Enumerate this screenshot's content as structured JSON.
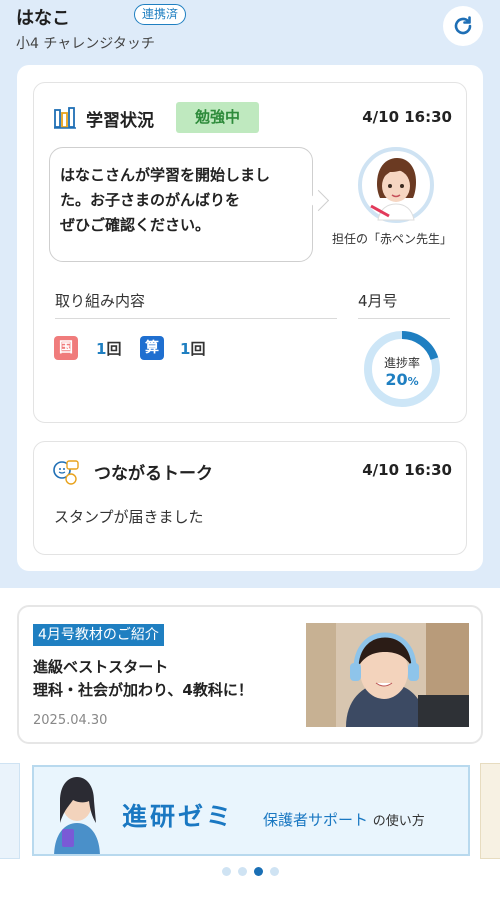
{
  "header": {
    "child_name": "はなこ",
    "link_status": "連携済",
    "grade_course": "小4 チャレンジタッチ",
    "refresh_icon": "refresh-icon"
  },
  "study_status": {
    "title": "学習状況",
    "status_badge": "勉強中",
    "time": "4/10 16:30",
    "message_lines": [
      "はなこさんが学習を開始しまし",
      "た。お子さまのがんばりを",
      "ぜひご確認ください。"
    ],
    "teacher_caption": "担任の「赤ペン先生」",
    "activity_label": "取り組み内容",
    "subjects": [
      {
        "tag": "国",
        "count": "1",
        "unit": "回",
        "color": "#f07c7c"
      },
      {
        "tag": "算",
        "count": "1",
        "unit": "回",
        "color": "#1f6fd0"
      }
    ],
    "issue_label": "4月号",
    "progress_label": "進捗率",
    "progress_value": "20",
    "progress_unit": "%",
    "progress_fraction": 0.2
  },
  "talk": {
    "title": "つながるトーク",
    "time": "4/10 16:30",
    "message": "スタンプが届きました"
  },
  "promo": {
    "badge": "4月号教材のご紹介",
    "line1": "進級ベストスタート",
    "line2": "理科・社会が加わり、4教科に！",
    "date": "2025.04.30"
  },
  "banner": {
    "brand": "進研ゼミ",
    "sub_main": "保護者サポート",
    "sub_small": "の使い方"
  },
  "carousel": {
    "page_count": 4,
    "active_index": 2
  },
  "colors": {
    "accent": "#1f7fc1",
    "background": "#deebf9",
    "badge_green": "#bfe9bf"
  }
}
